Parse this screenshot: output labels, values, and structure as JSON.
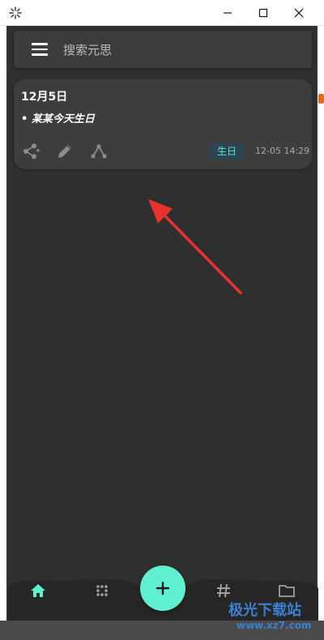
{
  "window": {
    "title": ""
  },
  "search": {
    "placeholder": "搜索元思"
  },
  "note": {
    "title": "12月5日",
    "body": "• 某某今天生日",
    "tag": "生日",
    "timestamp": "12-05 14:29"
  },
  "icons": {
    "app": "app-flower-icon",
    "minimize": "minimize-icon",
    "maximize": "maximize-icon",
    "close": "close-icon",
    "menu": "menu-icon",
    "share": "share-icon",
    "edit": "pencil-icon",
    "graph": "graph-icon",
    "home": "home-icon",
    "dots": "dots-grid-icon",
    "hashtag": "hashtag-icon",
    "folder": "folder-icon",
    "add": "plus-icon"
  },
  "watermark": {
    "text": "极光下载站",
    "sub": "www.xz7.com"
  },
  "colors": {
    "accent": "#5ff0d2",
    "background": "#2f2f2f",
    "card": "#3d3d3d",
    "arrow": "#e8322b"
  }
}
